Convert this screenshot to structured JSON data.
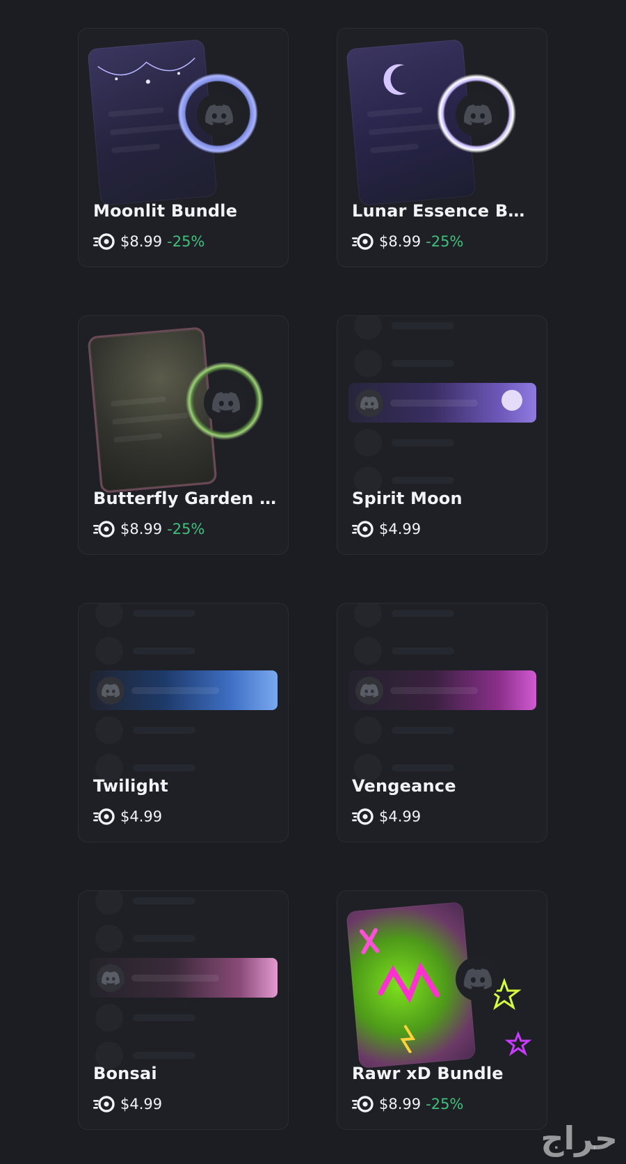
{
  "products": [
    {
      "name": "Moonlit Bundle",
      "price": "$8.99",
      "discount": "-25%",
      "type": "bundle",
      "icon": "nitro-icon"
    },
    {
      "name": "Lunar Essence Bun...",
      "price": "$8.99",
      "discount": "-25%",
      "type": "bundle",
      "icon": "nitro-icon"
    },
    {
      "name": "Butterfly Garden B...",
      "price": "$8.99",
      "discount": "-25%",
      "type": "bundle",
      "icon": "nitro-icon"
    },
    {
      "name": "Spirit Moon",
      "price": "$4.99",
      "discount": "",
      "type": "nameplate",
      "icon": "nitro-icon"
    },
    {
      "name": "Twilight",
      "price": "$4.99",
      "discount": "",
      "type": "nameplate",
      "icon": "nitro-icon"
    },
    {
      "name": "Vengeance",
      "price": "$4.99",
      "discount": "",
      "type": "nameplate",
      "icon": "nitro-icon"
    },
    {
      "name": "Bonsai",
      "price": "$4.99",
      "discount": "",
      "type": "nameplate",
      "icon": "nitro-icon"
    },
    {
      "name": "Rawr xD Bundle",
      "price": "$8.99",
      "discount": "-25%",
      "type": "bundle",
      "icon": "nitro-icon"
    }
  ],
  "watermark": "حراج",
  "colors": {
    "background": "#1c1d22",
    "card": "#1f2026",
    "discount": "#3ec07a",
    "text": "#f2f3f5"
  }
}
